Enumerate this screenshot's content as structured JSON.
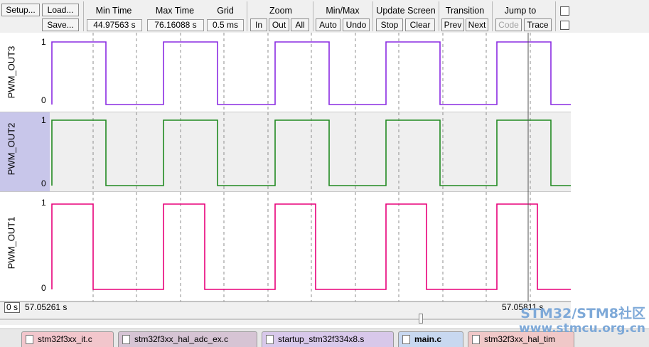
{
  "toolbar": {
    "setup_label": "Setup...",
    "load_label": "Load...",
    "save_label": "Save...",
    "min_time": {
      "label": "Min Time",
      "value": "44.97563 s"
    },
    "max_time": {
      "label": "Max Time",
      "value": "76.16088 s"
    },
    "grid": {
      "label": "Grid",
      "value": "0.5 ms"
    },
    "zoom": {
      "label": "Zoom",
      "in": "In",
      "out": "Out",
      "all": "All"
    },
    "minmax": {
      "label": "Min/Max",
      "auto": "Auto",
      "undo": "Undo"
    },
    "update_screen": {
      "label": "Update Screen",
      "stop": "Stop",
      "clear": "Clear"
    },
    "transition": {
      "label": "Transition",
      "prev": "Prev",
      "next": "Next"
    },
    "jump_to": {
      "label": "Jump to",
      "code": "Code",
      "trace": "Trace"
    }
  },
  "signals": [
    {
      "name": "PWM_OUT3",
      "high_label": "1",
      "low_label": "0",
      "color": "#8a2be2",
      "edges": [
        3,
        79,
        160,
        236,
        317,
        393,
        473,
        549,
        629,
        705
      ],
      "start_high": true,
      "selected": false
    },
    {
      "name": "PWM_OUT2",
      "high_label": "1",
      "low_label": "0",
      "color": "#218a21",
      "edges": [
        3,
        79,
        160,
        236,
        317,
        393,
        473,
        549,
        629,
        705
      ],
      "start_high": true,
      "selected": true
    },
    {
      "name": "PWM_OUT1",
      "high_label": "1",
      "low_label": "0",
      "color": "#e8007a",
      "edges": [
        3,
        61,
        160,
        218,
        317,
        374,
        473,
        530,
        629,
        686
      ],
      "start_high": true,
      "selected": false
    }
  ],
  "status": {
    "left_origin": "0 s",
    "cursor_time": "57.05261 s",
    "right_time": "57.05811 s"
  },
  "file_tabs": [
    {
      "label": "stm32f3xx_it.c",
      "color": "#f2c6cc"
    },
    {
      "label": "stm32f3xx_hal_adc_ex.c",
      "color": "#d6c4d4"
    },
    {
      "label": "startup_stm32f334x8.s",
      "color": "#d8c8ea"
    },
    {
      "label": "main.c",
      "color": "#c8d8f0"
    },
    {
      "label": "stm32f3xx_hal_tim",
      "color": "#f0c8c8"
    }
  ],
  "watermark": {
    "line1": "STM32/STM8社区",
    "line2": "www.stmcu.org.cn"
  }
}
